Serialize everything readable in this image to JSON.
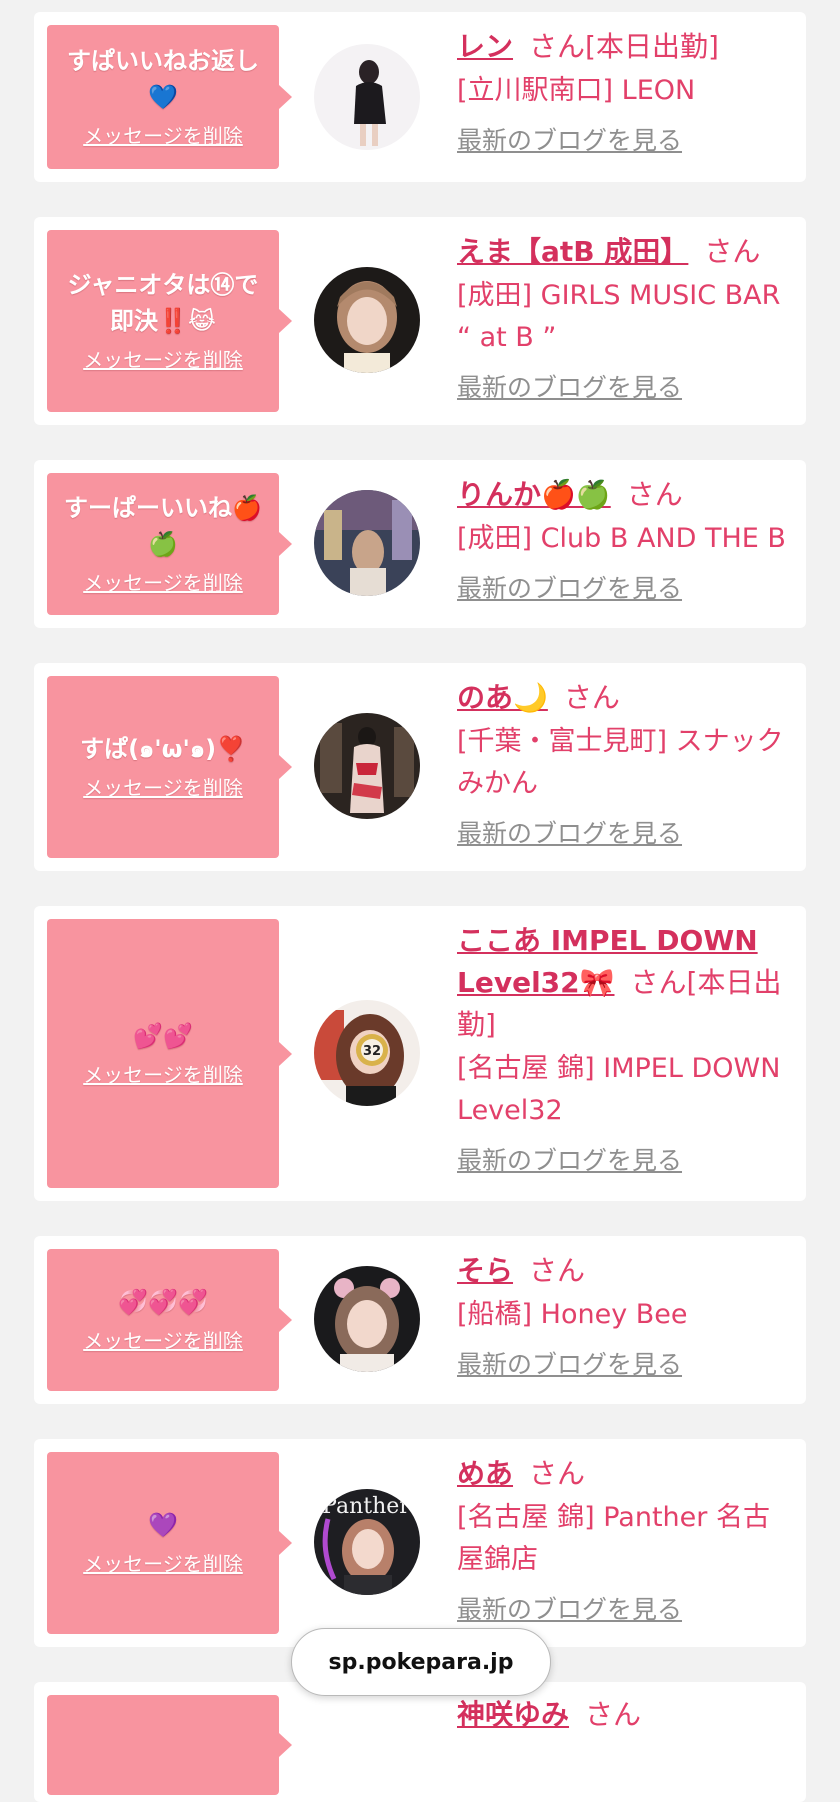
{
  "delete_label": "メッセージを削除",
  "blog_label": "最新のブログを見る",
  "san_suffix": "さん",
  "url_bar": {
    "domain": "sp.pokepara.jp"
  },
  "colors": {
    "bubble": "#f8949f",
    "name": "#d4305d",
    "shop": "#e2406a",
    "blog_link": "#8f8f8f"
  },
  "cards": [
    {
      "message": "すぱいいねお返し💙",
      "name": "レン",
      "status": "[本日出勤]",
      "shop": "[立川駅南口] LEON"
    },
    {
      "message": "ジャニオタは⑭で即決‼️😹",
      "name": "えま【atB 成田】",
      "status": "",
      "shop": "[成田] GIRLS MUSIC BAR “ at B ”"
    },
    {
      "message": "すーぱーいいね🍎🍏",
      "name": "りんか🍎🍏",
      "status": "",
      "shop": "[成田] Club B AND THE B"
    },
    {
      "message": "すぱ(๑'ω'๑)❣️",
      "name": "のあ🌙",
      "status": "",
      "shop": "[千葉・富士見町] スナックみかん"
    },
    {
      "message": "💕💕",
      "name": "ここあ IMPEL DOWN Level32🎀",
      "status": "[本日出勤]",
      "shop": "[名古屋 錦] IMPEL DOWN Level32"
    },
    {
      "message": "💞💞💞",
      "name": "そら",
      "status": "",
      "shop": "[船橋] Honey Bee"
    },
    {
      "message": "💜",
      "name": "めあ",
      "status": "",
      "shop": "[名古屋 錦] Panther 名古屋錦店"
    },
    {
      "message": "",
      "name": "神咲ゆみ",
      "status": "",
      "shop": ""
    }
  ]
}
